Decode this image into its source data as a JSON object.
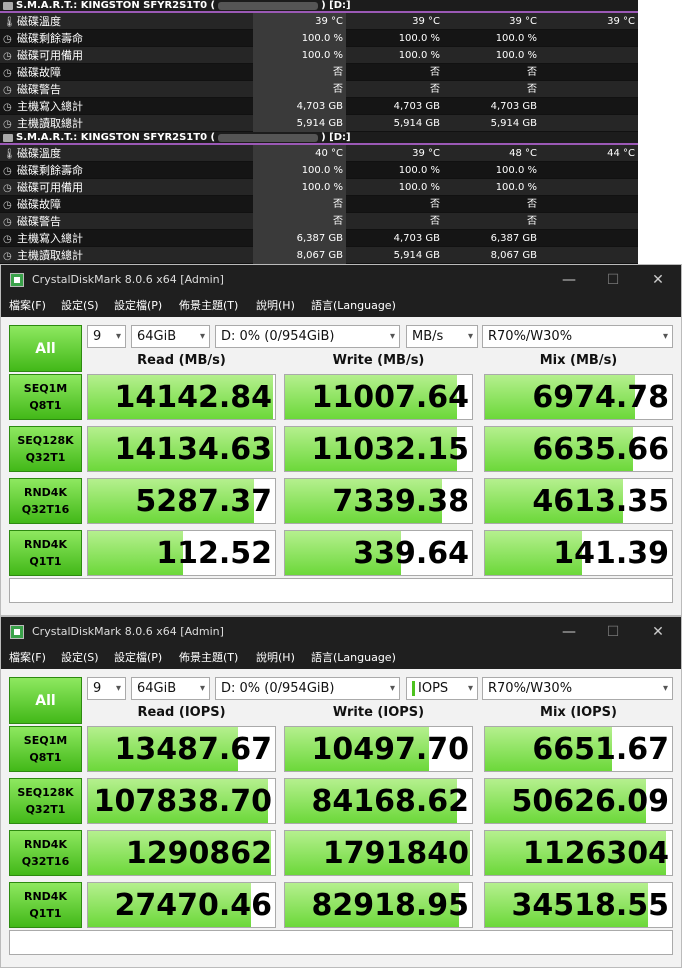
{
  "hwinfo": {
    "sections": [
      {
        "title": "S.M.A.R.T.: KINGSTON SFYR2S1T0 (",
        "title_suffix": ") [D:]",
        "rows": [
          {
            "icon": "thermometer-icon",
            "label": "磁碟溫度",
            "v1": "39 °C",
            "v2": "39 °C",
            "v3": "39 °C",
            "v4": "39 °C"
          },
          {
            "icon": "clock-icon",
            "label": "磁碟剩餘壽命",
            "v1": "100.0 %",
            "v2": "100.0 %",
            "v3": "100.0 %",
            "v4": ""
          },
          {
            "icon": "clock-icon",
            "label": "磁碟可用備用",
            "v1": "100.0 %",
            "v2": "100.0 %",
            "v3": "100.0 %",
            "v4": ""
          },
          {
            "icon": "clock-icon",
            "label": "磁碟故障",
            "v1": "否",
            "v2": "否",
            "v3": "否",
            "v4": ""
          },
          {
            "icon": "clock-icon",
            "label": "磁碟警告",
            "v1": "否",
            "v2": "否",
            "v3": "否",
            "v4": ""
          },
          {
            "icon": "clock-icon",
            "label": "主機寫入總計",
            "v1": "4,703 GB",
            "v2": "4,703 GB",
            "v3": "4,703 GB",
            "v4": ""
          },
          {
            "icon": "clock-icon",
            "label": "主機讀取總計",
            "v1": "5,914 GB",
            "v2": "5,914 GB",
            "v3": "5,914 GB",
            "v4": ""
          }
        ]
      },
      {
        "title": "S.M.A.R.T.: KINGSTON SFYR2S1T0 (",
        "title_suffix": ") [D:]",
        "rows": [
          {
            "icon": "thermometer-icon",
            "label": "磁碟溫度",
            "v1": "40 °C",
            "v2": "39 °C",
            "v3": "48 °C",
            "v4": "44 °C"
          },
          {
            "icon": "clock-icon",
            "label": "磁碟剩餘壽命",
            "v1": "100.0 %",
            "v2": "100.0 %",
            "v3": "100.0 %",
            "v4": ""
          },
          {
            "icon": "clock-icon",
            "label": "磁碟可用備用",
            "v1": "100.0 %",
            "v2": "100.0 %",
            "v3": "100.0 %",
            "v4": ""
          },
          {
            "icon": "clock-icon",
            "label": "磁碟故障",
            "v1": "否",
            "v2": "否",
            "v3": "否",
            "v4": ""
          },
          {
            "icon": "clock-icon",
            "label": "磁碟警告",
            "v1": "否",
            "v2": "否",
            "v3": "否",
            "v4": ""
          },
          {
            "icon": "clock-icon",
            "label": "主機寫入總計",
            "v1": "6,387 GB",
            "v2": "4,703 GB",
            "v3": "6,387 GB",
            "v4": ""
          },
          {
            "icon": "clock-icon",
            "label": "主機讀取總計",
            "v1": "8,067 GB",
            "v2": "5,914 GB",
            "v3": "8,067 GB",
            "v4": ""
          }
        ]
      }
    ]
  },
  "windows": [
    {
      "title": "CrystalDiskMark 8.0.6 x64 [Admin]",
      "menu": [
        "檔案(F)",
        "設定(S)",
        "設定檔(P)",
        "佈景主題(T)",
        "說明(H)",
        "語言(Language)"
      ],
      "all_label": "All",
      "count": "9",
      "size": "64GiB",
      "drive": "D: 0% (0/954GiB)",
      "unit": "MB/s",
      "mix": "R70%/W30%",
      "headers": [
        "Read (MB/s)",
        "Write (MB/s)",
        "Mix (MB/s)"
      ],
      "rows": [
        {
          "l1": "SEQ1M",
          "l2": "Q8T1",
          "read": "14142.84",
          "write": "11007.64",
          "mix": "6974.78",
          "read_fill": 0.99,
          "write_fill": 0.92,
          "mix_fill": 0.8
        },
        {
          "l1": "SEQ128K",
          "l2": "Q32T1",
          "read": "14134.63",
          "write": "11032.15",
          "mix": "6635.66",
          "read_fill": 0.99,
          "write_fill": 0.92,
          "mix_fill": 0.79
        },
        {
          "l1": "RND4K",
          "l2": "Q32T16",
          "read": "5287.37",
          "write": "7339.38",
          "mix": "4613.35",
          "read_fill": 0.89,
          "write_fill": 0.84,
          "mix_fill": 0.74
        },
        {
          "l1": "RND4K",
          "l2": "Q1T1",
          "read": "112.52",
          "write": "339.64",
          "mix": "141.39",
          "read_fill": 0.51,
          "write_fill": 0.62,
          "mix_fill": 0.52
        }
      ]
    },
    {
      "title": "CrystalDiskMark 8.0.6 x64 [Admin]",
      "menu": [
        "檔案(F)",
        "設定(S)",
        "設定檔(P)",
        "佈景主題(T)",
        "說明(H)",
        "語言(Language)"
      ],
      "all_label": "All",
      "count": "9",
      "size": "64GiB",
      "drive": "D: 0% (0/954GiB)",
      "unit": "IOPS",
      "mix": "R70%/W30%",
      "headers": [
        "Read (IOPS)",
        "Write (IOPS)",
        "Mix (IOPS)"
      ],
      "rows": [
        {
          "l1": "SEQ1M",
          "l2": "Q8T1",
          "read": "13487.67",
          "write": "10497.70",
          "mix": "6651.67",
          "read_fill": 0.8,
          "write_fill": 0.77,
          "mix_fill": 0.68
        },
        {
          "l1": "SEQ128K",
          "l2": "Q32T1",
          "read": "107838.70",
          "write": "84168.62",
          "mix": "50626.09",
          "read_fill": 0.96,
          "write_fill": 0.92,
          "mix_fill": 0.86
        },
        {
          "l1": "RND4K",
          "l2": "Q32T16",
          "read": "1290862",
          "write": "1791840",
          "mix": "1126304",
          "read_fill": 0.98,
          "write_fill": 0.99,
          "mix_fill": 0.97
        },
        {
          "l1": "RND4K",
          "l2": "Q1T1",
          "read": "27470.46",
          "write": "82918.95",
          "mix": "34518.55",
          "read_fill": 0.87,
          "write_fill": 0.93,
          "mix_fill": 0.87
        }
      ]
    }
  ],
  "colors": {
    "accent_green": "#42b818",
    "fill_green": "#6cd83a",
    "hwinfo_accent": "#d0143c",
    "hwinfo_header_line": "#9b59b6"
  }
}
